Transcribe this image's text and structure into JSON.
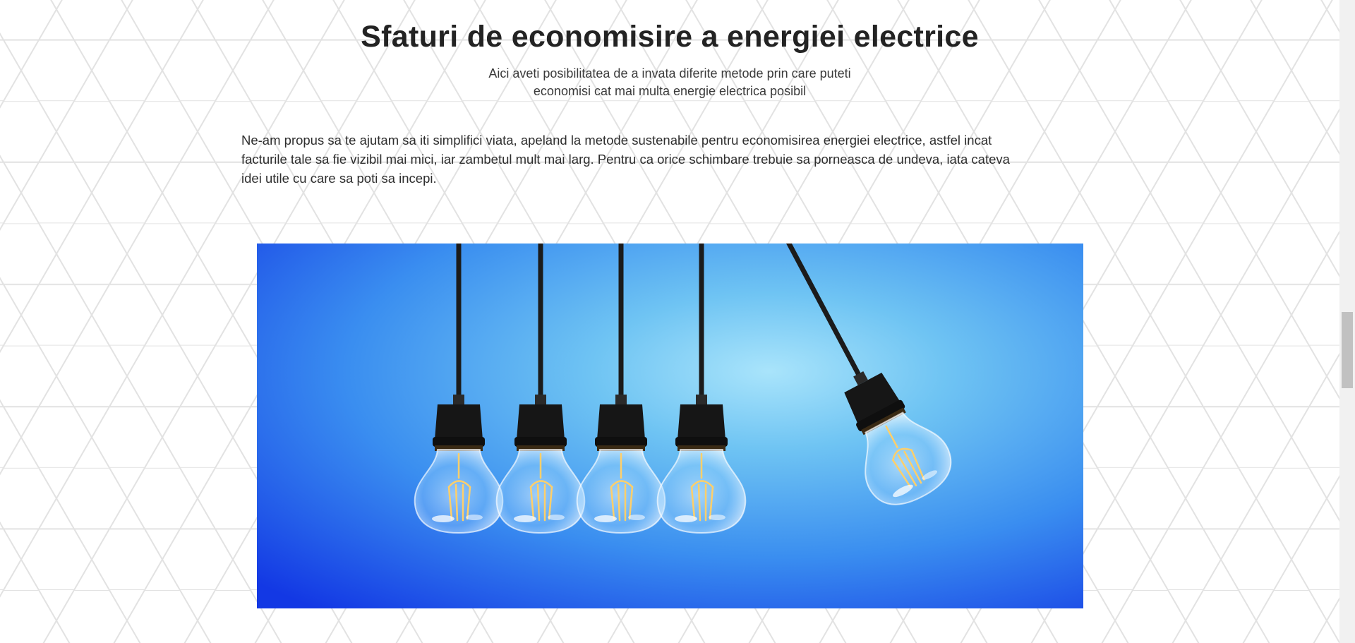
{
  "section": {
    "title": "Sfaturi de economisire a energiei electrice",
    "subtitle_line1": "Aici aveti posibilitatea de a invata diferite metode prin care puteti",
    "subtitle_line2": "economisi cat mai multa energie electrica posibil",
    "intro_line1": "Ne-am propus sa te ajutam sa iti simplifici viata, apeland la metode sustenabile pentru economisirea energiei electrice, astfel incat",
    "intro_line2": "facturile tale sa fie vizibil mai mici, iar zambetul mult mai larg. Pentru ca orice schimbare trebuie sa porneasca de undeva, iata cateva",
    "intro_line3": "idei utile cu care sa poti sa incepi."
  },
  "image": {
    "subject": "five hanging light bulbs on blue background",
    "bulb_count": 5
  },
  "colors": {
    "background": "#ffffff",
    "hex_pattern": "#e4e4e4",
    "sky_light": "#8fd8f5",
    "sky_dark": "#1a44e6",
    "socket": "#141414",
    "filament": "#ffcf6a"
  },
  "scrollbar": {
    "position_fraction": 0.55
  }
}
